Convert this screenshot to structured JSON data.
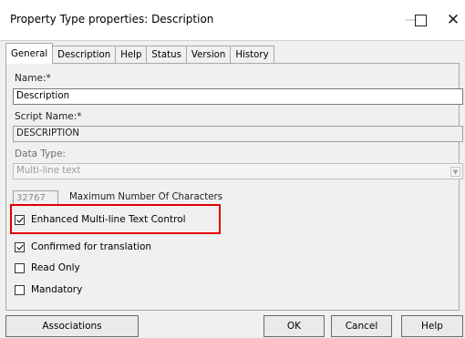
{
  "window": {
    "title": "Property Type properties: Description",
    "minimize_label": "—",
    "close_label": "✕"
  },
  "tabs": [
    "General",
    "Description",
    "Help",
    "Status",
    "Version",
    "History"
  ],
  "form": {
    "name_label": "Name:*",
    "name_value": "Description",
    "script_name_label": "Script Name:*",
    "script_name_value": "DESCRIPTION",
    "data_type_label": "Data Type:",
    "data_type_value": "Multi-line text",
    "max_chars_value": "32767",
    "max_chars_label": "Maximum Number Of Characters"
  },
  "checkboxes": [
    {
      "label": "Enhanced Multi-line Text Control",
      "checked": true
    },
    {
      "label": "Confirmed for translation",
      "checked": true
    },
    {
      "label": "Read Only",
      "checked": false
    },
    {
      "label": "Mandatory",
      "checked": false
    }
  ],
  "buttons": {
    "associations": "Associations",
    "ok": "OK",
    "cancel": "Cancel",
    "help": "Help"
  },
  "colors": {
    "highlight": "#e00000"
  }
}
